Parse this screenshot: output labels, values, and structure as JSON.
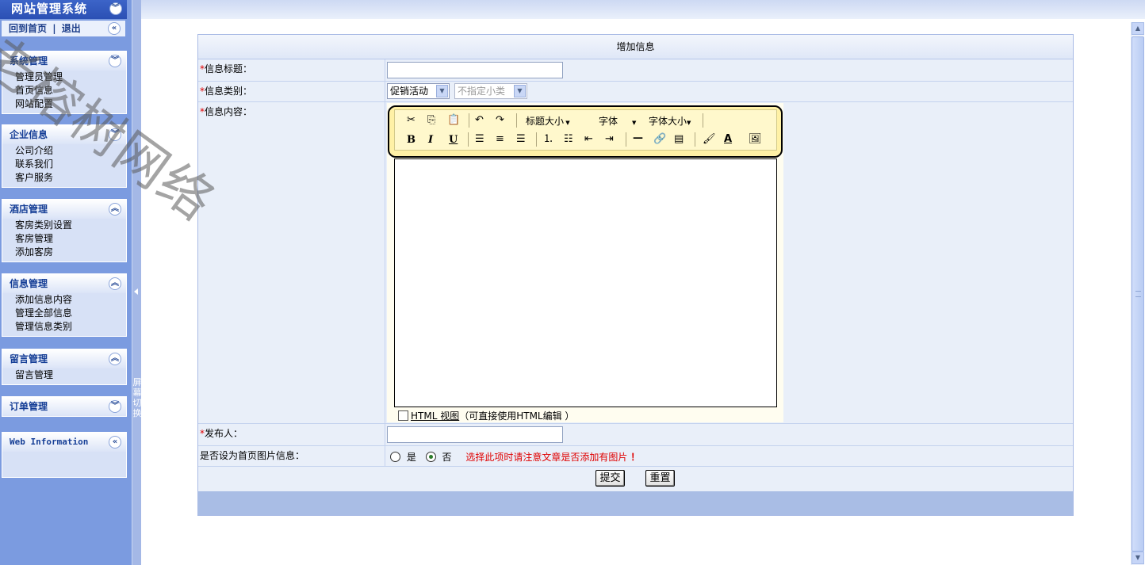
{
  "sidebar": {
    "title": "网站管理系统",
    "home_link": "回到首页",
    "separator": "|",
    "logout_link": "退出",
    "groups": [
      {
        "title": "系统管理",
        "items": [
          "管理员管理",
          "首页信息",
          "网站配置"
        ]
      },
      {
        "title": "企业信息",
        "items": [
          "公司介绍",
          "联系我们",
          "客户服务"
        ]
      },
      {
        "title": "酒店管理",
        "items": [
          "客房类别设置",
          "客房管理",
          "添加客房"
        ]
      },
      {
        "title": "信息管理",
        "items": [
          "添加信息内容",
          "管理全部信息",
          "管理信息类别"
        ]
      },
      {
        "title": "留言管理",
        "items": [
          "留言管理"
        ]
      },
      {
        "title": "订单管理",
        "items": []
      },
      {
        "title": "Web Information",
        "items": []
      }
    ]
  },
  "splitter": {
    "label": "屏幕切换"
  },
  "form": {
    "title": "增加信息",
    "required_mark": "*",
    "title_label": "信息标题：",
    "title_value": "",
    "category_label": "信息类别：",
    "category_selected": "促销活动",
    "subcategory_selected": "不指定小类",
    "content_label": "信息内容：",
    "editor": {
      "toolbar": {
        "heading_size": "标题大小",
        "font": "字体",
        "font_size": "字体大小"
      },
      "html_view_label": "HTML 视图",
      "html_view_hint": "（可直接使用HTML编辑 ）"
    },
    "publisher_label": "发布人：",
    "publisher_value": "",
    "homepage_image_label": "是否设为首页图片信息：",
    "option_yes": "是",
    "option_no": "否",
    "homepage_image_selected": "否",
    "warning": "选择此项时请注意文章是否添加有图片",
    "warning_mark": "！",
    "submit": "提交",
    "reset": "重置"
  },
  "watermark": "老榕树网络",
  "colors": {
    "sidebar_bg": "#7b9be0",
    "header_blue": "#2b50b4",
    "required": "#e00000"
  }
}
